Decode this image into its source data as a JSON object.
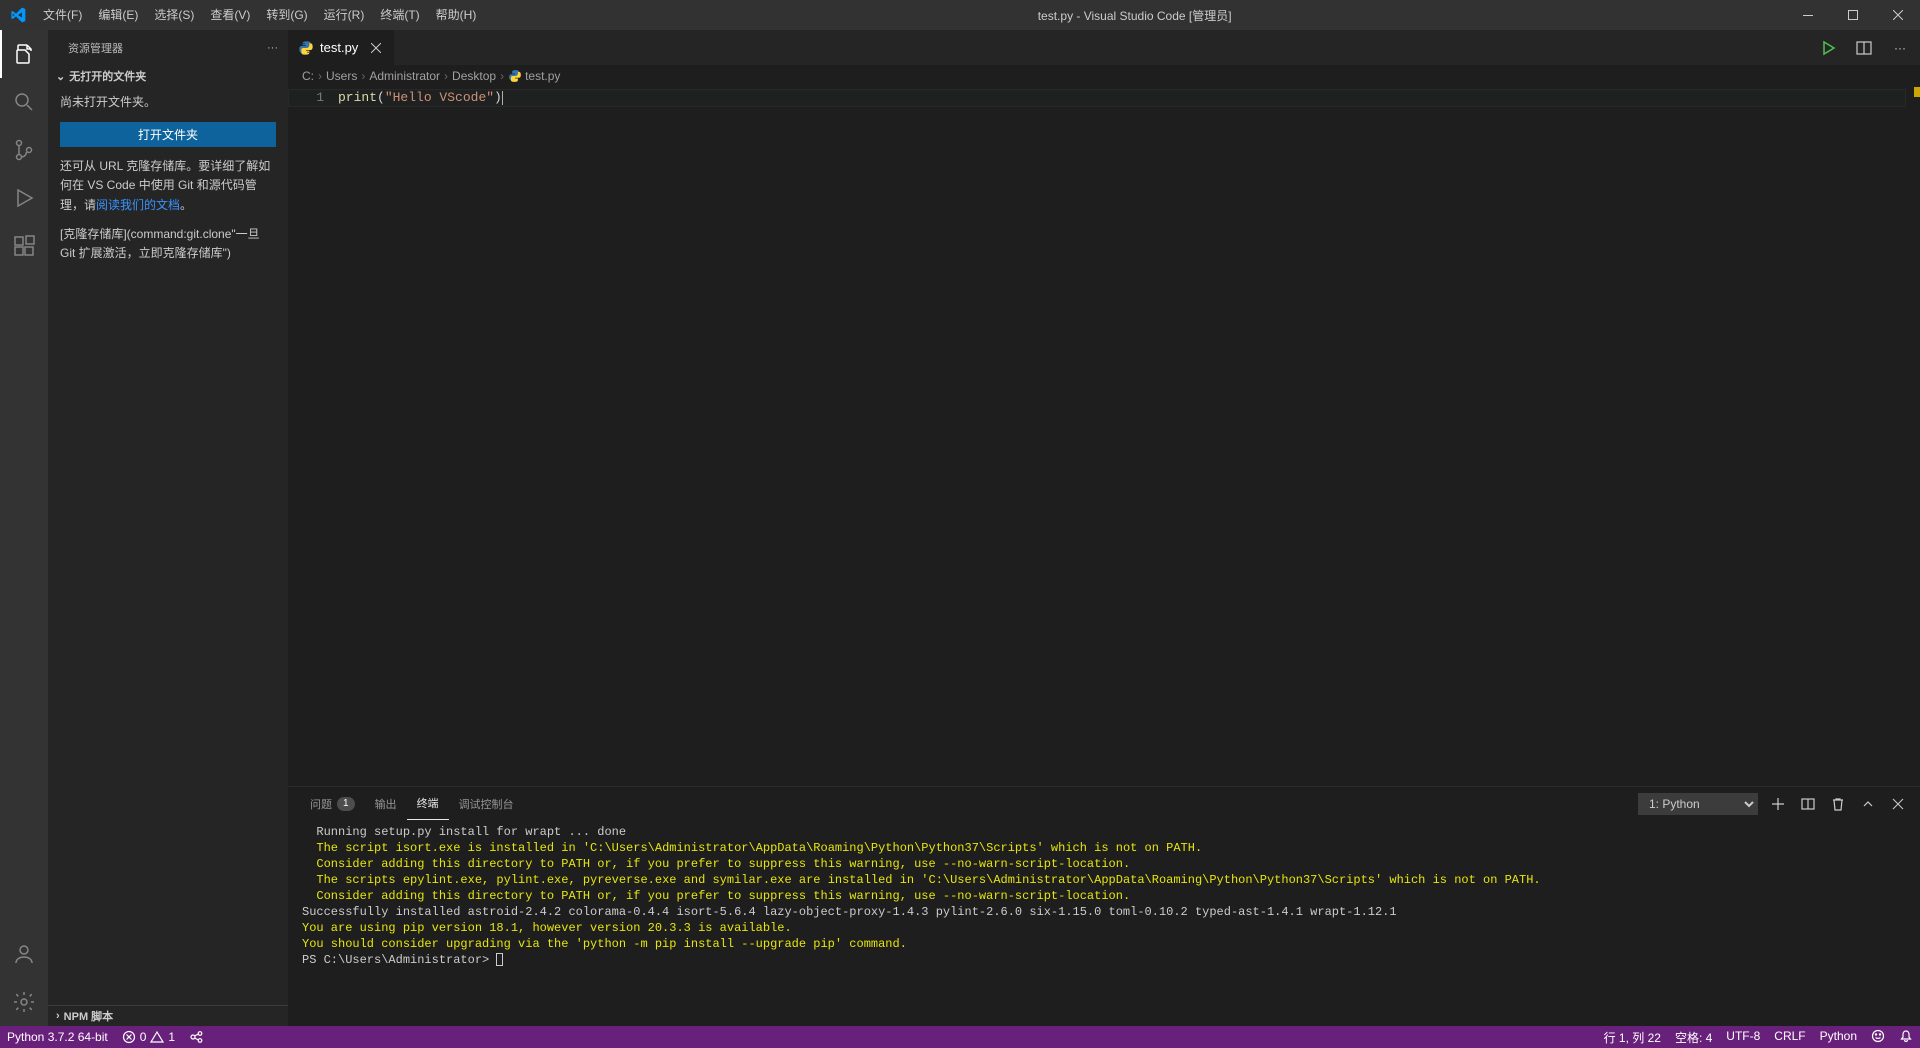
{
  "titlebar": {
    "menu": [
      "文件(F)",
      "编辑(E)",
      "选择(S)",
      "查看(V)",
      "转到(G)",
      "运行(R)",
      "终端(T)",
      "帮助(H)"
    ],
    "title": "test.py - Visual Studio Code [管理员]"
  },
  "sidebar": {
    "header_title": "资源管理器",
    "section_title": "无打开的文件夹",
    "body_line1": "尚未打开文件夹。",
    "open_folder_btn": "打开文件夹",
    "para2_a": "还可从 URL 克隆存储库。要详细了解如何在 VS Code 中使用 Git 和源代码管理，请",
    "para2_link": "阅读我们的文档",
    "para2_b": "。",
    "para3": "[克隆存储库](command:git.clone\"一旦 Git 扩展激活，立即克隆存储库\")",
    "bottom_section": "NPM 脚本"
  },
  "tab": {
    "filename": "test.py"
  },
  "breadcrumbs": [
    "C:",
    "Users",
    "Administrator",
    "Desktop",
    "test.py"
  ],
  "code": {
    "line_number": "1",
    "fn": "print",
    "open": "(",
    "str": "\"Hello VScode\"",
    "close": ")"
  },
  "panel": {
    "tabs": {
      "problems": "问题",
      "problems_count": "1",
      "output": "输出",
      "terminal": "终端",
      "debug": "调试控制台"
    },
    "dropdown_selected": "1: Python",
    "terminal_lines": [
      {
        "cls": "to-white",
        "text": "  Running setup.py install for wrapt ... done"
      },
      {
        "cls": "to-yellow",
        "text": "  The script isort.exe is installed in 'C:\\Users\\Administrator\\AppData\\Roaming\\Python\\Python37\\Scripts' which is not on PATH."
      },
      {
        "cls": "to-yellow",
        "text": "  Consider adding this directory to PATH or, if you prefer to suppress this warning, use --no-warn-script-location."
      },
      {
        "cls": "to-yellow",
        "text": "  The scripts epylint.exe, pylint.exe, pyreverse.exe and symilar.exe are installed in 'C:\\Users\\Administrator\\AppData\\Roaming\\Python\\Python37\\Scripts' which is not on PATH."
      },
      {
        "cls": "to-yellow",
        "text": "  Consider adding this directory to PATH or, if you prefer to suppress this warning, use --no-warn-script-location."
      },
      {
        "cls": "to-white",
        "text": "Successfully installed astroid-2.4.2 colorama-0.4.4 isort-5.6.4 lazy-object-proxy-1.4.3 pylint-2.6.0 six-1.15.0 toml-0.10.2 typed-ast-1.4.1 wrapt-1.12.1"
      },
      {
        "cls": "to-yellow",
        "text": "You are using pip version 18.1, however version 20.3.3 is available."
      },
      {
        "cls": "to-yellow",
        "text": "You should consider upgrading via the 'python -m pip install --upgrade pip' command."
      }
    ],
    "prompt": "PS C:\\Users\\Administrator> "
  },
  "statusbar": {
    "python_env": "Python 3.7.2 64-bit",
    "errors": "0",
    "warnings": "1",
    "cursor_pos": "行 1, 列 22",
    "spaces": "空格: 4",
    "encoding": "UTF-8",
    "eol": "CRLF",
    "lang": "Python"
  }
}
